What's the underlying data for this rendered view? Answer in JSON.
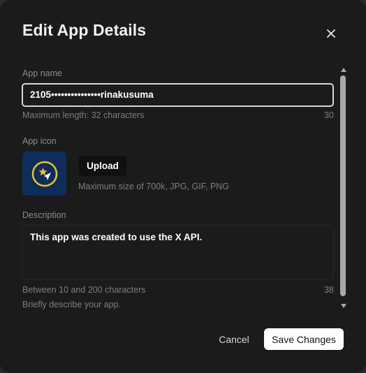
{
  "dialog": {
    "title": "Edit App Details",
    "close_icon": "close-icon"
  },
  "app_name": {
    "label": "App name",
    "value": "2105•••••••••••••••rinakusuma",
    "hint": "Maximum length: 32 characters",
    "count": "30"
  },
  "app_icon": {
    "label": "App icon",
    "icon": "star-compass-icon",
    "upload_label": "Upload",
    "hint": "Maximum size of 700k, JPG, GIF, PNG"
  },
  "description": {
    "label": "Description",
    "value": "This app was created to use the X API.",
    "hint": "Between 10 and 200 characters",
    "count": "38",
    "helper": "Briefly describe your app."
  },
  "actions": {
    "cancel_label": "Cancel",
    "save_label": "Save Changes"
  },
  "colors": {
    "background": "#1b1b1b",
    "icon_bg": "#0f2d5c",
    "icon_accent": "#f2c31b",
    "primary_button": "#ffffff"
  }
}
